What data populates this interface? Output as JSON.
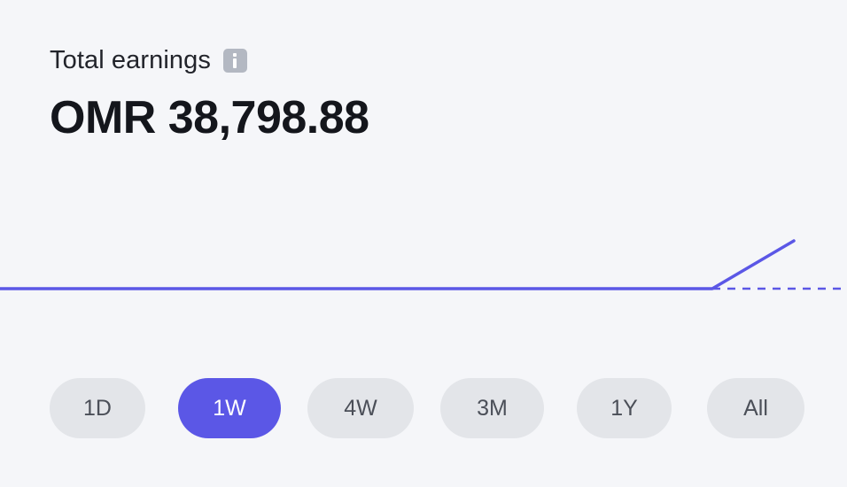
{
  "header": {
    "label": "Total earnings",
    "amount": "OMR 38,798.88"
  },
  "icons": {
    "info": "info-icon"
  },
  "colors": {
    "accent": "#5b57e6",
    "pill_bg": "#e3e5e9",
    "background": "#f5f6f9"
  },
  "periods": [
    {
      "label": "1D",
      "active": false
    },
    {
      "label": "1W",
      "active": true
    },
    {
      "label": "4W",
      "active": false
    },
    {
      "label": "3M",
      "active": false
    },
    {
      "label": "1Y",
      "active": false
    },
    {
      "label": "All",
      "active": false
    }
  ],
  "chart_data": {
    "type": "line",
    "series": [
      {
        "values": [
          0,
          0,
          0,
          0,
          0,
          0,
          1
        ]
      }
    ],
    "projection": {
      "style": "dashed"
    },
    "grid": false,
    "xlabel": "",
    "ylabel": ""
  }
}
